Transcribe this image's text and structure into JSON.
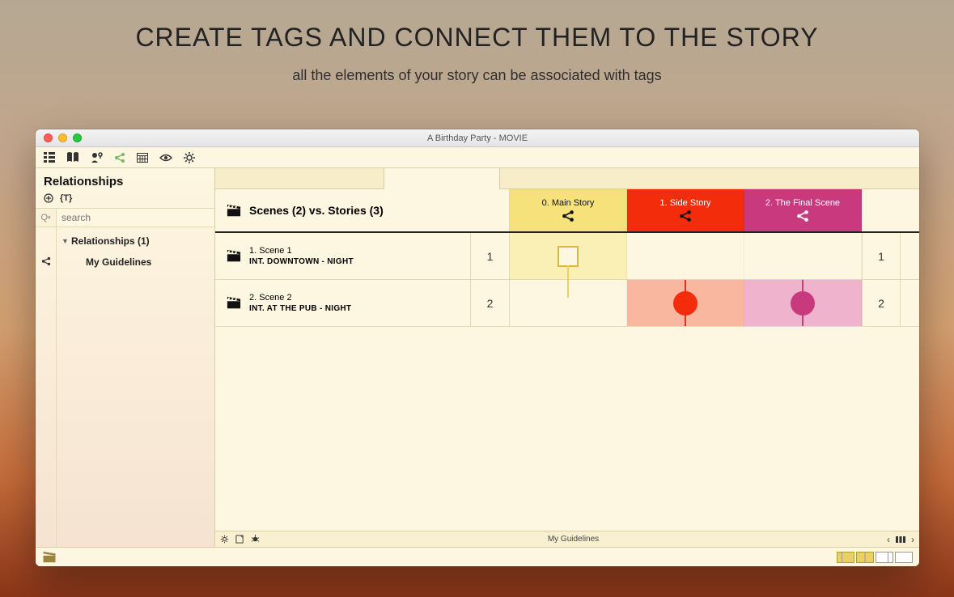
{
  "hero": {
    "title": "CREATE TAGS AND CONNECT THEM TO THE STORY",
    "subtitle": "all the elements of your story can be associated with tags"
  },
  "window": {
    "title": "A Birthday Party - MOVIE"
  },
  "sidebar": {
    "header": "Relationships",
    "search_placeholder": "search",
    "tree": {
      "root_label": "Relationships (1)",
      "child_label": "My Guidelines"
    }
  },
  "matrix": {
    "header_label": "Scenes (2) vs. Stories (3)",
    "columns": [
      {
        "label": "0. Main Story"
      },
      {
        "label": "1. Side Story"
      },
      {
        "label": "2. The Final Scene"
      }
    ],
    "rows": [
      {
        "num": "1",
        "title": "1.  Scene 1",
        "slug": "INT.  DOWNTOWN - NIGHT",
        "right_num": "1"
      },
      {
        "num": "2",
        "title": "2.  Scene 2",
        "slug": "INT.  AT THE PUB - NIGHT",
        "right_num": "2"
      }
    ]
  },
  "status": {
    "center": "My Guidelines"
  }
}
